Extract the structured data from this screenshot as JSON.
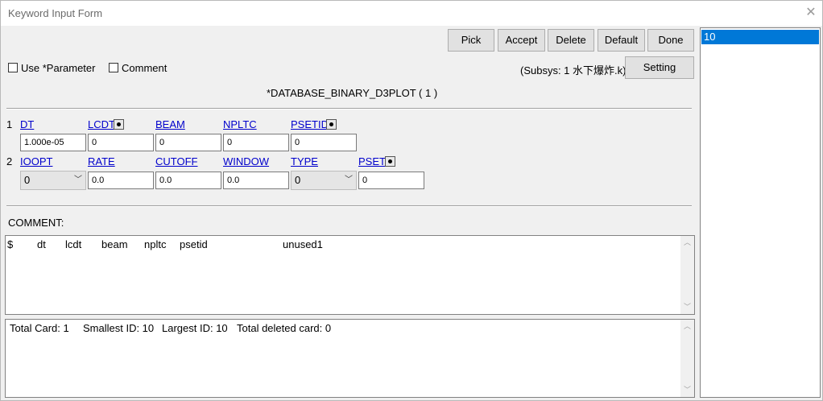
{
  "window": {
    "title": "Keyword Input Form",
    "close_icon": "close-icon"
  },
  "toolbar": {
    "pick": "Pick",
    "accept": "Accept",
    "delete": "Delete",
    "default": "Default",
    "done": "Done",
    "setting": "Setting"
  },
  "options": {
    "use_parameter": "Use *Parameter",
    "comment": "Comment",
    "use_parameter_checked": false,
    "comment_checked": false
  },
  "subsys": "(Subsys: 1 水下爆炸.k)",
  "keyword_title": "*DATABASE_BINARY_D3PLOT    ( 1 )",
  "card1": {
    "row": "1",
    "labels": {
      "dt": "DT",
      "lcdt": "LCDT",
      "beam": "BEAM",
      "npltc": "NPLTC",
      "psetid": "PSETID"
    },
    "values": {
      "dt": "1.000e-05",
      "lcdt": "0",
      "beam": "0",
      "npltc": "0",
      "psetid": "0"
    }
  },
  "card2": {
    "row": "2",
    "labels": {
      "ioopt": "IOOPT",
      "rate": "RATE",
      "cutoff": "CUTOFF",
      "window": "WINDOW",
      "type": "TYPE",
      "pset": "PSET"
    },
    "values": {
      "ioopt": "0",
      "rate": "0.0",
      "cutoff": "0.0",
      "window": "0.0",
      "type": "0",
      "pset": "0"
    }
  },
  "comment_section": {
    "label": "COMMENT:",
    "columns": [
      "$",
      "dt",
      "lcdt",
      "beam",
      "npltc",
      "psetid",
      "unused1"
    ]
  },
  "status": {
    "total_card": "Total Card:  1",
    "smallest_id": "Smallest ID: 10",
    "largest_id": "Largest ID: 10",
    "total_deleted": "Total deleted card:  0"
  },
  "id_list": {
    "items": [
      "10"
    ],
    "selected": "10",
    "selected_color": "#0078d7"
  }
}
